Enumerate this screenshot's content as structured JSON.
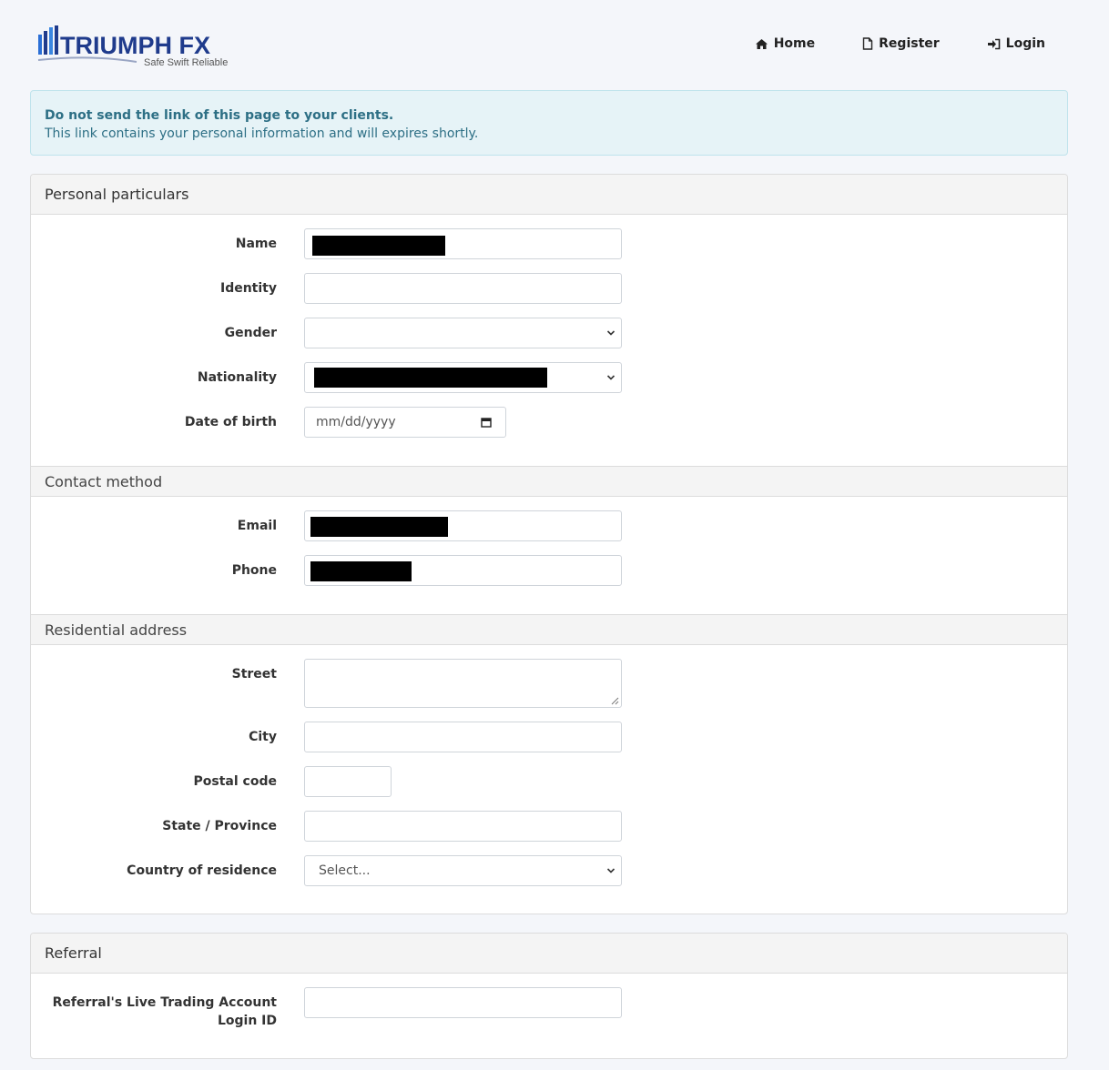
{
  "brand": {
    "name": "TRIUMPH FX",
    "tagline": "Safe Swift Reliable",
    "logo_icon": "chart-bars-logo"
  },
  "nav": [
    {
      "label": "Home",
      "icon": "home-icon"
    },
    {
      "label": "Register",
      "icon": "file-icon"
    },
    {
      "label": "Login",
      "icon": "sign-in-icon"
    }
  ],
  "alert": {
    "title": "Do not send the link of this page to your clients.",
    "body": "This link contains your personal information and will expires shortly."
  },
  "personal": {
    "title": "Personal particulars",
    "name_label": "Name",
    "identity_label": "Identity",
    "gender_label": "Gender",
    "nationality_label": "Nationality",
    "dob_label": "Date of birth",
    "dob_placeholder": "mm/dd/yyyy"
  },
  "contact": {
    "title": "Contact method",
    "email_label": "Email",
    "phone_label": "Phone"
  },
  "address": {
    "title": "Residential address",
    "street_label": "Street",
    "city_label": "City",
    "postal_label": "Postal code",
    "state_label": "State / Province",
    "country_label": "Country of residence",
    "country_value": "Select..."
  },
  "referral": {
    "title": "Referral",
    "login_label_line1": "Referral's Live Trading Account",
    "login_label_line2": "Login ID"
  },
  "colors": {
    "brand_blue": "#1f3b8c",
    "alert_text": "#2d6f85",
    "alert_bg": "#e6f3f7"
  }
}
